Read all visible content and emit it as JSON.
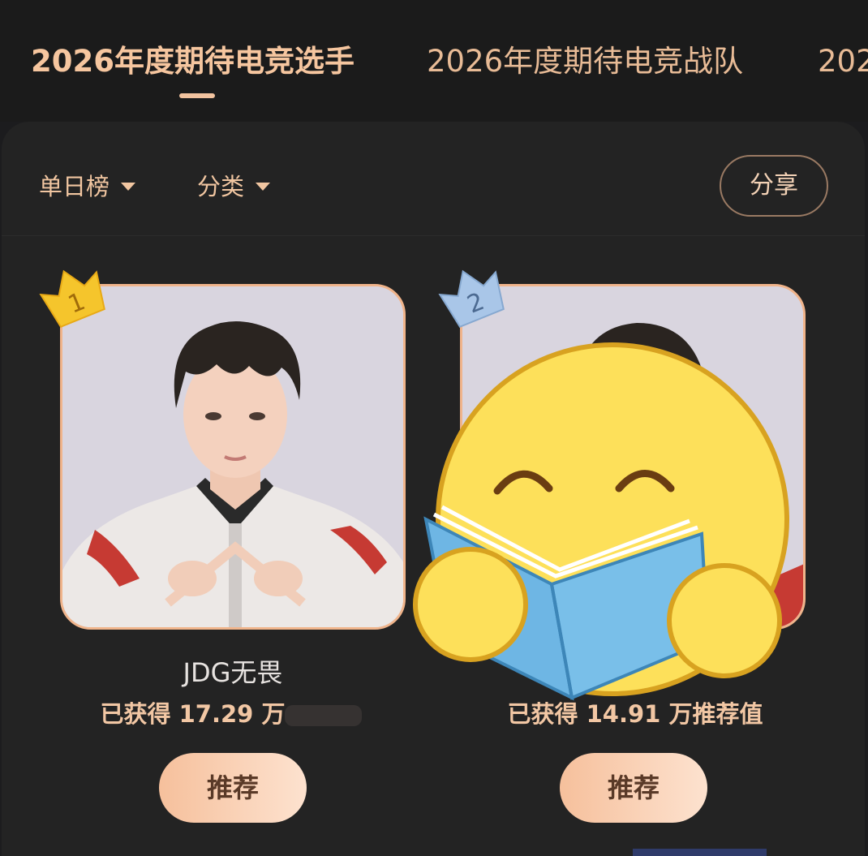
{
  "tabs": [
    {
      "label": "2026年度期待电竞选手",
      "active": true
    },
    {
      "label": "2026年度期待电竞战队",
      "active": false
    },
    {
      "label": "202",
      "active": false
    }
  ],
  "filters": {
    "daily_label": "单日榜",
    "category_label": "分类",
    "share_label": "分享"
  },
  "players": [
    {
      "rank": "1",
      "name": "JDG无畏",
      "points": "已获得 17.29 万",
      "button": "推荐",
      "badge_color": "#f5c52c"
    },
    {
      "rank": "2",
      "name": "",
      "points": "已获得 14.91 万推荐值",
      "button": "推荐",
      "badge_color": "#a9c6e8"
    }
  ],
  "colors": {
    "accent": "#f2c39f",
    "background": "#1c1c1e",
    "panel": "#232323"
  },
  "icons": [
    "caret-down-icon",
    "crown-rank-badge-icon",
    "reading-emoji-sticker"
  ]
}
